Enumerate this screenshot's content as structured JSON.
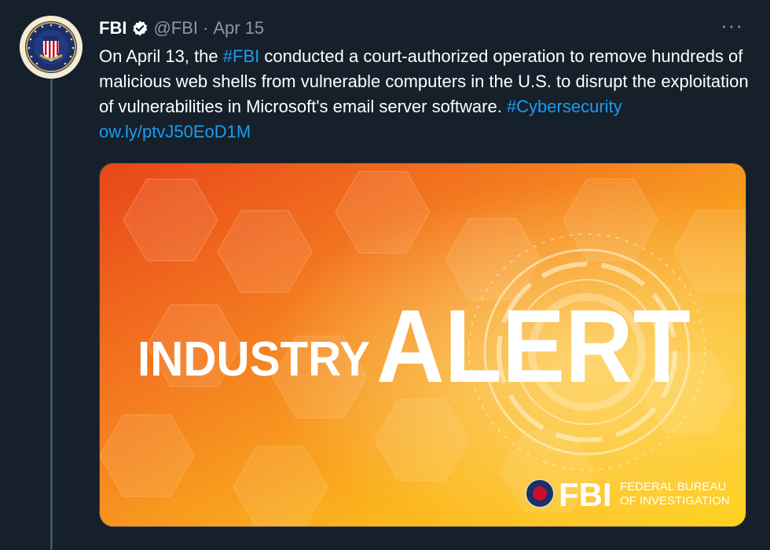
{
  "tweet": {
    "display_name": "FBI",
    "handle": "@FBI",
    "separator": "·",
    "date": "Apr 15",
    "more_label": "···",
    "text": {
      "part1": "On April 13, the ",
      "hashtag1": "#FBI",
      "part2": " conducted a court-authorized operation to remove hundreds of malicious web shells from vulnerable computers in the U.S. to disrupt the exploitation of vulnerabilities in Microsoft's email server software. ",
      "hashtag2": "#Cybersecurity",
      "space": " ",
      "link": "ow.ly/ptvJ50EoD1M"
    }
  },
  "media": {
    "headline_small": "INDUSTRY",
    "headline_large": "ALERT",
    "footer_logo_text": "FBI",
    "footer_line1": "FEDERAL BUREAU",
    "footer_line2": "OF INVESTIGATION"
  },
  "colors": {
    "background": "#15202b",
    "link": "#1d9bf0",
    "secondary_text": "#8b98a5",
    "verified_badge": "#ffffff",
    "alert_orange": "#f26b1d",
    "alert_yellow": "#ffd21f"
  },
  "icons": {
    "verified": "verified-badge-icon",
    "more": "more-options-icon",
    "seal": "fbi-seal-icon"
  }
}
